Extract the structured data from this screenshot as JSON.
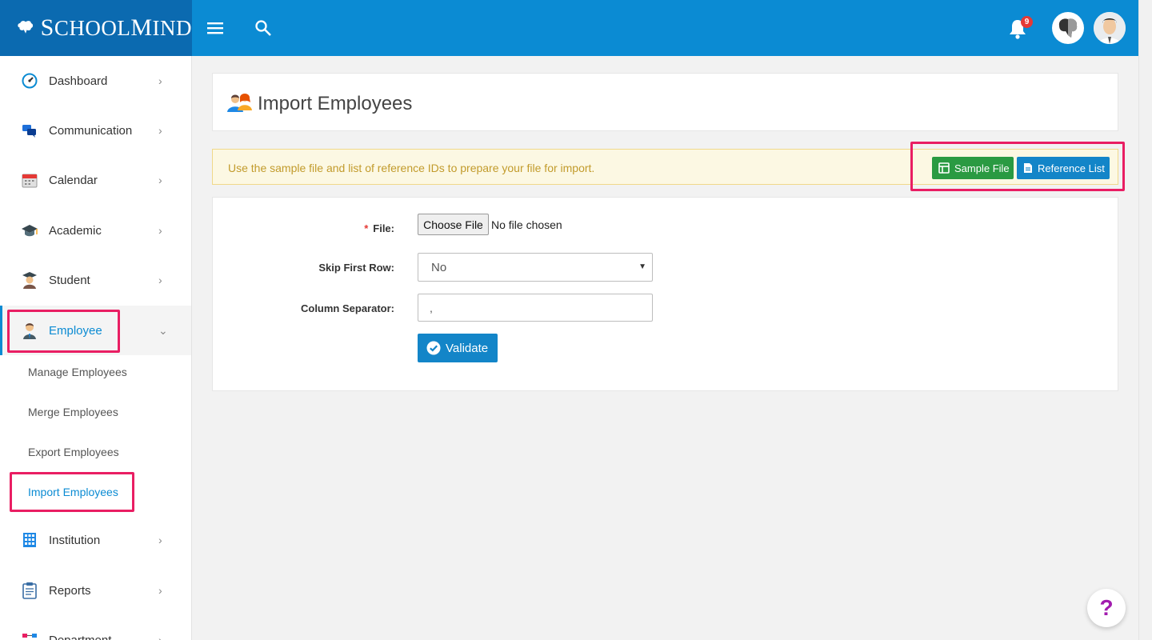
{
  "brand": {
    "name_first": "S",
    "name_mid": "CHOOL",
    "name_m": "M",
    "name_last": "IND"
  },
  "topbar": {
    "menu_icon": "hamburger-icon",
    "search_icon": "search-icon",
    "notification_count": "9"
  },
  "sidebar": {
    "items": [
      {
        "label": "Dashboard",
        "icon": "dashboard-icon"
      },
      {
        "label": "Communication",
        "icon": "chat-icon"
      },
      {
        "label": "Calendar",
        "icon": "calendar-icon"
      },
      {
        "label": "Academic",
        "icon": "graduation-cap-icon"
      },
      {
        "label": "Student",
        "icon": "student-icon"
      },
      {
        "label": "Employee",
        "icon": "employee-icon"
      },
      {
        "label": "Institution",
        "icon": "building-icon"
      },
      {
        "label": "Reports",
        "icon": "clipboard-icon"
      },
      {
        "label": "Department",
        "icon": "department-icon"
      }
    ],
    "sub_items": [
      "Manage Employees",
      "Merge Employees",
      "Export Employees",
      "Import Employees"
    ]
  },
  "page": {
    "title": "Import Employees"
  },
  "alert": {
    "text": "Use the sample file and list of reference IDs to prepare your file for import.",
    "sample_file_label": "Sample File",
    "reference_list_label": "Reference List"
  },
  "form": {
    "file_label": "File:",
    "file_button": "Choose File",
    "file_status": "No file chosen",
    "skip_label": "Skip First Row:",
    "skip_value": "No",
    "separator_label": "Column Separator:",
    "separator_value": ",",
    "validate_label": "Validate"
  },
  "help": {
    "label": "?"
  },
  "colors": {
    "topbar": "#0b8bd3",
    "logo_bg": "#0b6ab0",
    "highlight": "#e91e63",
    "success": "#2a9a42",
    "primary": "#1385c8"
  }
}
